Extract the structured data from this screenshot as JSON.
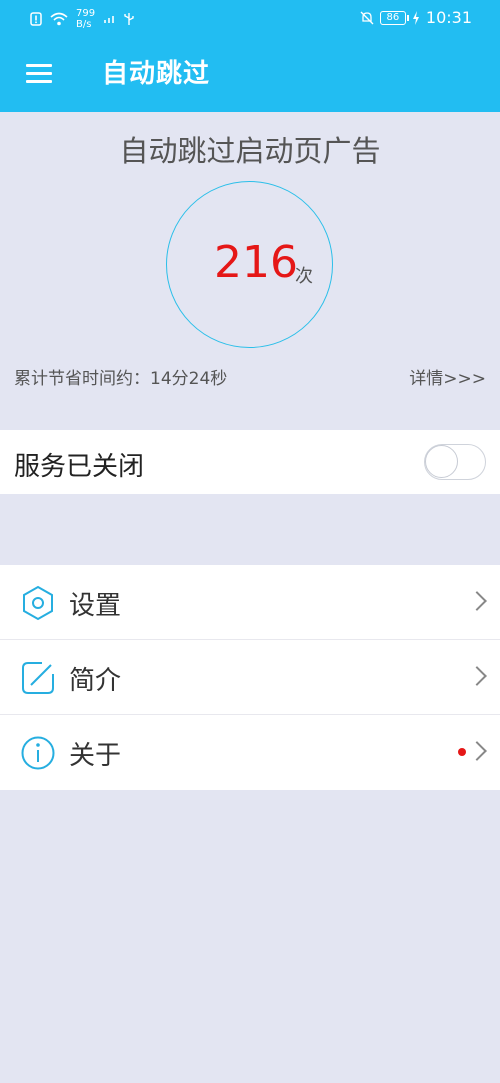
{
  "status_bar": {
    "speed_value": "799",
    "speed_unit": "B/s",
    "battery": "86",
    "time": "10:31",
    "icons": [
      "alert-icon",
      "wifi-icon",
      "signal-icon",
      "usb-icon",
      "mute-icon",
      "battery-icon",
      "charging-icon"
    ]
  },
  "app_bar": {
    "title": "自动跳过",
    "menu_icon": "hamburger-icon",
    "background": "#22bdf2"
  },
  "summary": {
    "headline": "自动跳过启动页广告",
    "count": "216",
    "count_unit": "次",
    "saved_time": "累计节省时间约：14分24秒",
    "details_link": "详情>>>",
    "count_color": "#e51717"
  },
  "service": {
    "label": "服务已关闭",
    "enabled": false
  },
  "menu": {
    "items": [
      {
        "label": "设置",
        "icon": "settings-hex-icon",
        "badge": false
      },
      {
        "label": "简介",
        "icon": "edit-icon",
        "badge": false
      },
      {
        "label": "关于",
        "icon": "info-icon",
        "badge": true
      }
    ]
  }
}
